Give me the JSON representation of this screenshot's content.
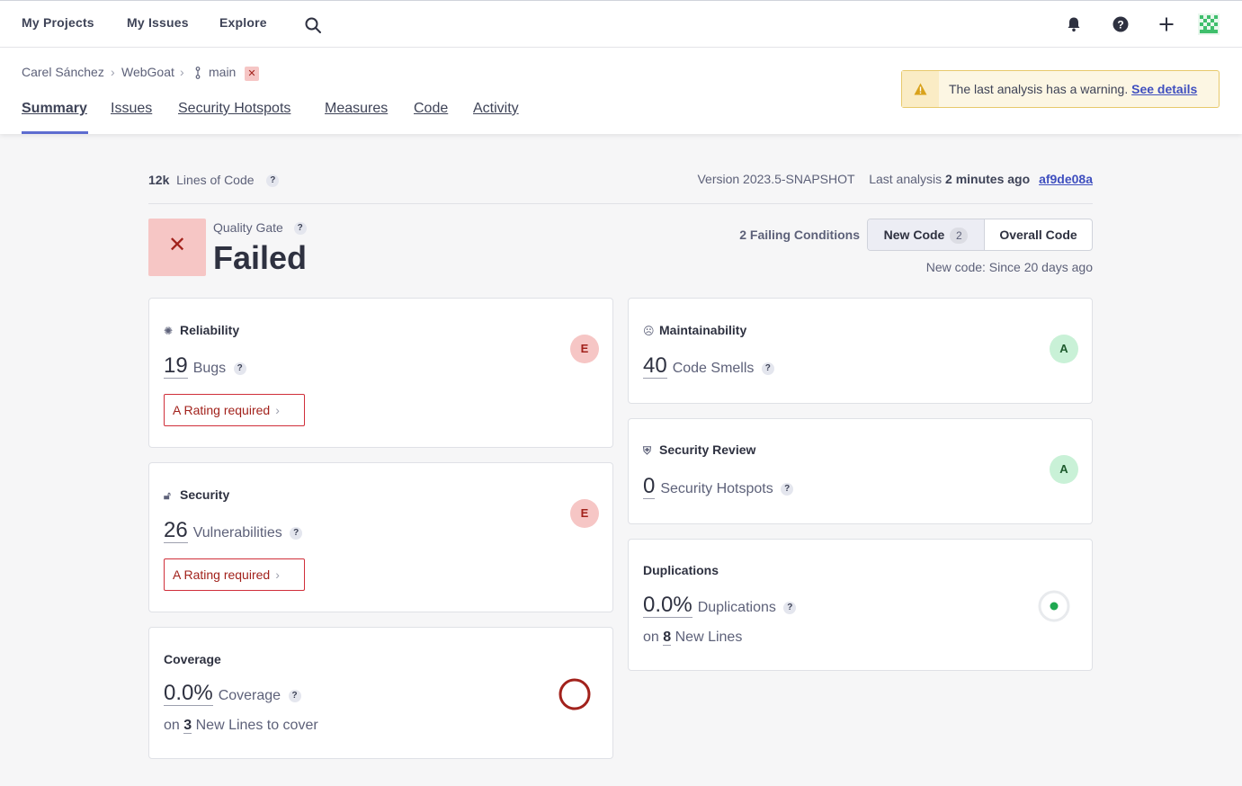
{
  "nav": {
    "items": [
      "My Projects",
      "My Issues",
      "Explore"
    ],
    "icons": [
      "search-icon",
      "bell-icon",
      "help-icon",
      "plus-icon",
      "avatar"
    ]
  },
  "breadcrumb": {
    "org": "Carel Sánchez",
    "project": "WebGoat",
    "branch": "main"
  },
  "tabs": [
    "Summary",
    "Issues",
    "Security Hotspots",
    "Measures",
    "Code",
    "Activity"
  ],
  "warning": {
    "text": "The last analysis has a warning.",
    "link": "See details"
  },
  "meta": {
    "loc_value": "12k",
    "loc_label": "Lines of Code",
    "version": "Version 2023.5-SNAPSHOT",
    "last_analysis_label": "Last analysis",
    "last_analysis_time": "2 minutes ago",
    "commit": "af9de08a"
  },
  "quality_gate": {
    "label": "Quality Gate",
    "status": "Failed",
    "failing": "2 Failing Conditions",
    "new_code_label": "New Code",
    "new_code_count": "2",
    "overall_label": "Overall Code",
    "since": "New code: Since 20 days ago"
  },
  "cards": {
    "reliability": {
      "title": "Reliability",
      "value": "19",
      "label": "Bugs",
      "rating": "E",
      "requirement": "A Rating required"
    },
    "security": {
      "title": "Security",
      "value": "26",
      "label": "Vulnerabilities",
      "rating": "E",
      "requirement": "A Rating required"
    },
    "coverage": {
      "title": "Coverage",
      "value": "0.0%",
      "label": "Coverage",
      "on": "on",
      "lines": "3",
      "lines_label": "New Lines to cover"
    },
    "maintainability": {
      "title": "Maintainability",
      "value": "40",
      "label": "Code Smells",
      "rating": "A"
    },
    "security_review": {
      "title": "Security Review",
      "value": "0",
      "label": "Security Hotspots",
      "rating": "A"
    },
    "duplications": {
      "title": "Duplications",
      "value": "0.0%",
      "label": "Duplications",
      "on": "on",
      "lines": "8",
      "lines_label": "New Lines"
    }
  },
  "colors": {
    "accent": "#5d6cd0",
    "error": "#a2221c",
    "error_bg": "#f6c6c5",
    "success_bg": "#c9f1d7",
    "warning_bg": "#fcf6e3"
  }
}
